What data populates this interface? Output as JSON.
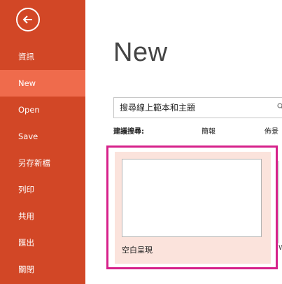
{
  "sidebar": {
    "items": [
      {
        "label": "資訊"
      },
      {
        "label": "New",
        "active": true
      },
      {
        "label": "Open"
      },
      {
        "label": "Save"
      },
      {
        "label": "另存新檔"
      },
      {
        "label": "列印"
      },
      {
        "label": "共用"
      },
      {
        "label": "匯出"
      },
      {
        "label": "關閉"
      }
    ]
  },
  "main": {
    "title": "New",
    "search": {
      "value": "搜尋線上範本和主題",
      "icon": "search-icon"
    },
    "suggested": {
      "label": "建議搜尋:",
      "links": [
        "簡報",
        "佈景"
      ]
    },
    "templates": [
      {
        "label": "空白呈現"
      }
    ]
  },
  "colors": {
    "sidebar": "#d24726",
    "sidebar_active": "#ef6b4c",
    "tile_background": "#fbe3dc",
    "highlight": "#d6218a"
  }
}
